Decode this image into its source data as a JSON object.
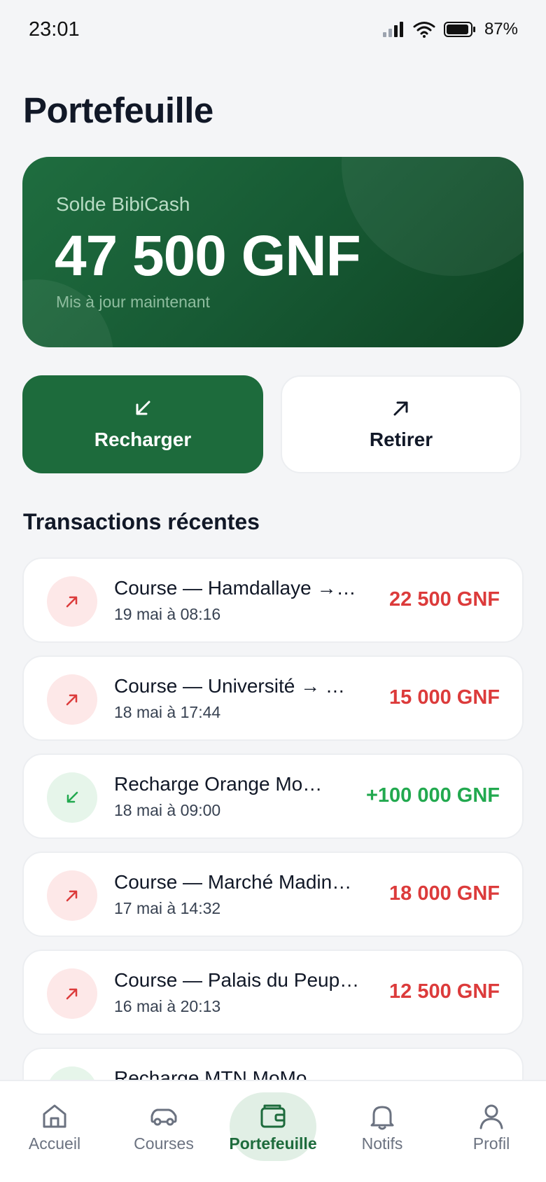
{
  "status": {
    "time": "23:01",
    "battery_pct": "87%",
    "icons": [
      "signal-icon",
      "wifi-icon",
      "battery-icon"
    ]
  },
  "page": {
    "title": "Portefeuille"
  },
  "balance": {
    "label": "Solde BibiCash",
    "amount": "47 500 GNF",
    "updated": "Mis à jour maintenant"
  },
  "actions": {
    "recharge": {
      "label": "Recharger",
      "icon": "arrow-down-left-icon"
    },
    "withdraw": {
      "label": "Retirer",
      "icon": "arrow-up-right-icon"
    }
  },
  "transactions": {
    "title": "Transactions récentes",
    "items": [
      {
        "title": "Course — Hamdallaye →…",
        "date": "19 mai à 08:16",
        "amount": "22 500 GNF",
        "type": "out"
      },
      {
        "title": "Course — Université → …",
        "date": "18 mai à 17:44",
        "amount": "15 000 GNF",
        "type": "out"
      },
      {
        "title": "Recharge Orange Mo…",
        "date": "18 mai à 09:00",
        "amount": "+100 000 GNF",
        "type": "in"
      },
      {
        "title": "Course — Marché Madin…",
        "date": "17 mai à 14:32",
        "amount": "18 000 GNF",
        "type": "out"
      },
      {
        "title": "Course — Palais du Peup…",
        "date": "16 mai à 20:13",
        "amount": "12 500 GNF",
        "type": "out"
      },
      {
        "title": "Recharge MTN MoMo",
        "date": "",
        "amount": "",
        "type": "in"
      }
    ]
  },
  "nav": {
    "items": [
      {
        "label": "Accueil",
        "icon": "home-icon"
      },
      {
        "label": "Courses",
        "icon": "car-icon"
      },
      {
        "label": "Portefeuille",
        "icon": "wallet-icon",
        "active": true
      },
      {
        "label": "Notifs",
        "icon": "bell-icon"
      },
      {
        "label": "Profil",
        "icon": "user-icon"
      }
    ]
  },
  "colors": {
    "brand": "#1d6b3c",
    "debit": "#dc3b3b",
    "credit": "#22a94f"
  }
}
